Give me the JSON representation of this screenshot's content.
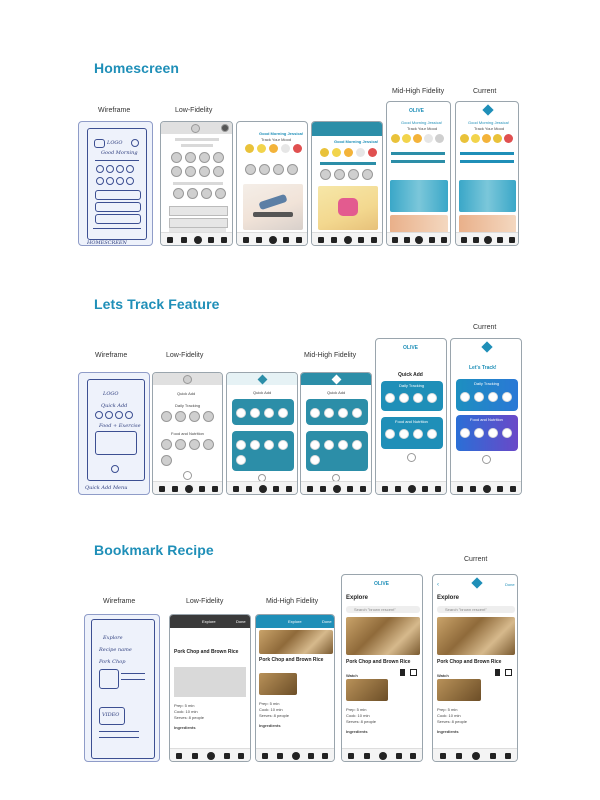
{
  "sections": {
    "homescreen": "Homescreen",
    "track": "Lets Track Feature",
    "bookmark": "Bookmark Recipe"
  },
  "stages": {
    "wireframe": "Wireframe",
    "low": "Low-Fidelity",
    "midhigh": "Mid-High Fidelity",
    "current": "Current"
  },
  "phone_text": {
    "olive": "OLIVE",
    "explore": "Explore",
    "quick_add": "Quick Add",
    "lets_track": "Let's Track!",
    "daily_tracking": "Daily Tracking",
    "food_nutrition": "Food and Nutrition",
    "recipe_title": "Pork Chop and Brown Rice",
    "search_placeholder": "Search \"brown rescent\"",
    "watch": "Watch",
    "prep": "Prep: 5 min",
    "cook": "Cook: 10 min",
    "serves": "Serves: 8 people",
    "ingredients": "Ingredients",
    "done": "Done",
    "good_morning": "Good Morning Jessica!",
    "track_your_mood": "Track Your Mood",
    "sketch_logo": "LOGO",
    "sketch_good_morning": "Good Morning",
    "sketch_quick_add": "Quick Add",
    "sketch_food": "Food + Exercise",
    "sketch_homescreen": "HOMESCREEN",
    "sketch_quick_menu": "Quick Add Menu",
    "sketch_explore": "Explore",
    "sketch_recipe_name": "Recipe name",
    "sketch_pork_chop": "Pork Chop",
    "sketch_video": "VIDEO"
  },
  "colors": {
    "accent": "#1f8fb8",
    "teal": "#2c8ea8",
    "wire_ink": "#3c4f92",
    "mood": [
      "#e9c23a",
      "#f2d44c",
      "#f3b33a",
      "#e6e6e6",
      "#cfcfcf",
      "#e05050"
    ]
  }
}
